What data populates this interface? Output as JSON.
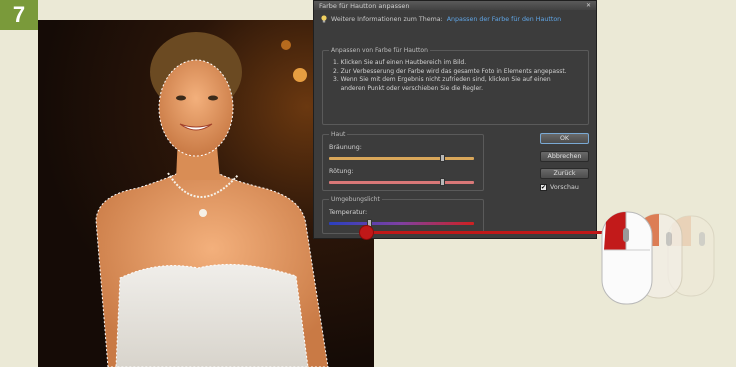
{
  "step_number": "7",
  "dialog": {
    "title": "Farbe für Hautton anpassen",
    "info_text": "Weitere Informationen zum Thema:",
    "info_link": "Anpassen der Farbe für den Hautton",
    "instructions": {
      "legend": "Anpassen von Farbe für Hautton",
      "steps": [
        "1. Klicken Sie auf einen Hautbereich im Bild.",
        "2. Zur Verbesserung der Farbe wird das gesamte Foto in Elements angepasst.",
        "3. Wenn Sie mit dem Ergebnis nicht zufrieden sind, klicken Sie auf einen",
        "    anderen Punkt oder verschieben Sie die Regler."
      ]
    },
    "hue_group": {
      "legend": "Haut",
      "sliders": [
        {
          "label": "Bräunung:",
          "value_pct": 78,
          "track_color": "#d9a75a"
        },
        {
          "label": "Rötung:",
          "value_pct": 78,
          "track_color": "#d97878"
        }
      ]
    },
    "ambient_group": {
      "legend": "Umgebungslicht",
      "sliders": [
        {
          "label": "Temperatur:",
          "value_pct": 28
        }
      ]
    },
    "buttons": {
      "ok": "OK",
      "cancel": "Abbrechen",
      "reset": "Zurück"
    },
    "preview": {
      "label": "Vorschau",
      "checked": true
    }
  },
  "colors": {
    "badge": "#7a9a3a",
    "pointer": "#c01818",
    "link": "#5fa5e6"
  }
}
